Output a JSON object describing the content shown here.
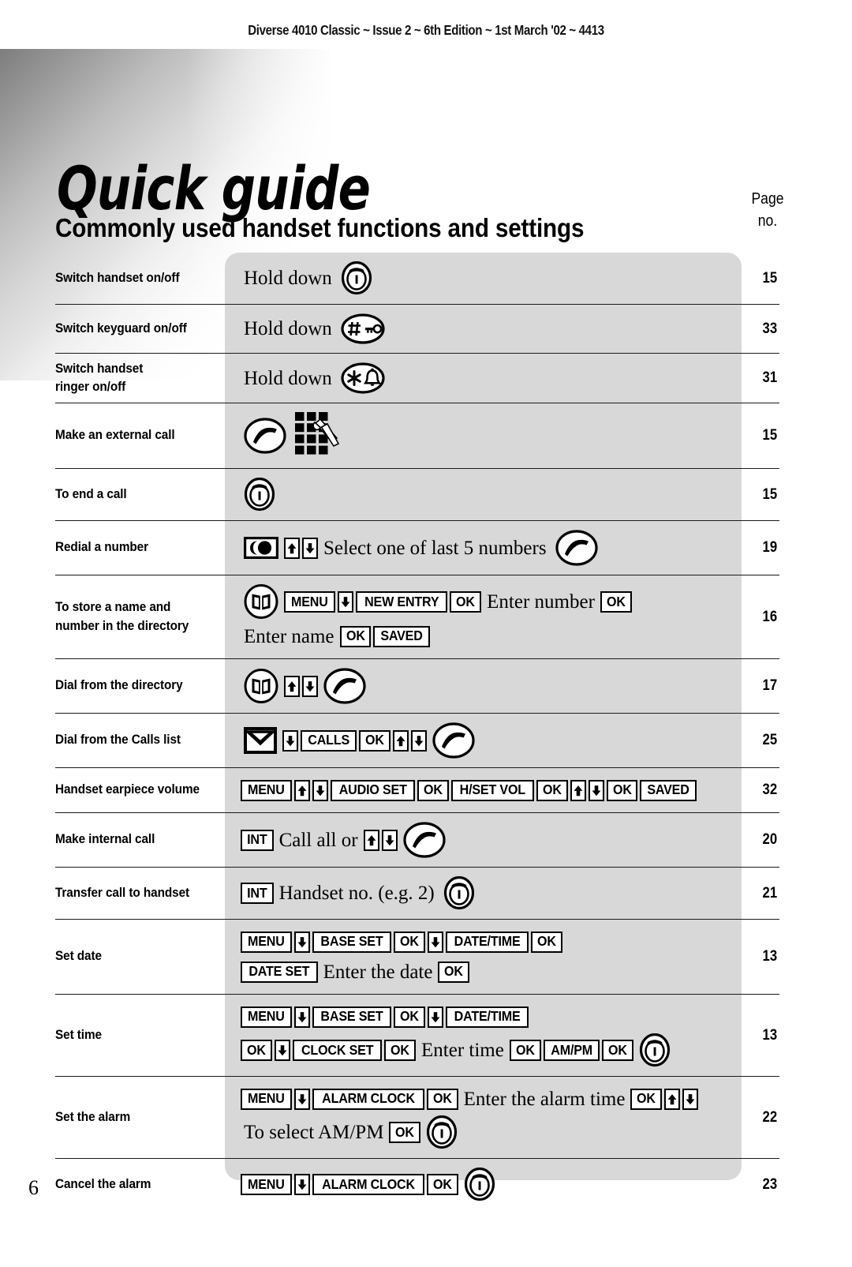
{
  "header": {
    "running_head": "Diverse 4010 Classic ~ Issue 2 ~ 6th Edition ~ 1st March '02 ~ 4413"
  },
  "title": {
    "main": "Quick guide",
    "subtitle": "Commonly used handset functions and settings",
    "page_col_header_line1": "Page",
    "page_col_header_line2": "no."
  },
  "footer": {
    "page_number": "6"
  },
  "colors": {
    "panel_grey": "#d8d8d8",
    "rule": "#1a1a1a",
    "text": "#000000"
  },
  "table": {
    "rows": [
      {
        "label": "Switch handset on/off",
        "page": "15",
        "lines": [
          [
            {
              "type": "word",
              "text": "Hold down"
            },
            {
              "type": "icon",
              "name": "end-call-icon"
            }
          ]
        ]
      },
      {
        "label": "Switch keyguard on/off",
        "page": "33",
        "lines": [
          [
            {
              "type": "word",
              "text": "Hold down"
            },
            {
              "type": "icon",
              "name": "keyguard-icon"
            }
          ]
        ]
      },
      {
        "label": "Switch handset\nringer on/off",
        "page": "31",
        "lines": [
          [
            {
              "type": "word",
              "text": "Hold down"
            },
            {
              "type": "icon",
              "name": "ringer-icon"
            }
          ]
        ]
      },
      {
        "label": "Make an external call",
        "page": "15",
        "lines": [
          [
            {
              "type": "icon",
              "name": "talk-icon"
            },
            {
              "type": "icon",
              "name": "keypad-dial-icon"
            }
          ]
        ]
      },
      {
        "label": "To end a call",
        "page": "15",
        "lines": [
          [
            {
              "type": "icon",
              "name": "end-call-icon"
            }
          ]
        ]
      },
      {
        "label": "Redial a number",
        "page": "19",
        "lines": [
          [
            {
              "type": "icon",
              "name": "redial-key-icon"
            },
            {
              "type": "key-up"
            },
            {
              "type": "key-down"
            },
            {
              "type": "word",
              "text": "Select one of last 5 numbers"
            },
            {
              "type": "icon",
              "name": "talk-icon"
            }
          ]
        ]
      },
      {
        "label": "To store a name and\nnumber in the directory",
        "page": "16",
        "lines": [
          [
            {
              "type": "icon",
              "name": "directory-book-icon"
            },
            {
              "type": "key",
              "text": "MENU"
            },
            {
              "type": "key-down"
            },
            {
              "type": "key",
              "text": "NEW ENTRY"
            },
            {
              "type": "key",
              "text": "OK"
            },
            {
              "type": "word",
              "text": "Enter number"
            },
            {
              "type": "key",
              "text": "OK"
            }
          ],
          [
            {
              "type": "word",
              "text": "Enter name"
            },
            {
              "type": "key",
              "text": "OK"
            },
            {
              "type": "key",
              "text": "SAVED"
            }
          ]
        ]
      },
      {
        "label": "Dial from the directory",
        "page": "17",
        "lines": [
          [
            {
              "type": "icon",
              "name": "directory-book-icon"
            },
            {
              "type": "key-up"
            },
            {
              "type": "key-down"
            },
            {
              "type": "icon",
              "name": "talk-icon"
            }
          ]
        ]
      },
      {
        "label": "Dial from the Calls list",
        "page": "25",
        "lines": [
          [
            {
              "type": "icon",
              "name": "envelope-icon"
            },
            {
              "type": "key-down"
            },
            {
              "type": "key",
              "text": "CALLS"
            },
            {
              "type": "key",
              "text": "OK"
            },
            {
              "type": "key-up"
            },
            {
              "type": "key-down"
            },
            {
              "type": "icon",
              "name": "talk-icon"
            }
          ]
        ]
      },
      {
        "label": "Handset earpiece volume",
        "page": "32",
        "lines": [
          [
            {
              "type": "key",
              "text": "MENU"
            },
            {
              "type": "key-up"
            },
            {
              "type": "key-down"
            },
            {
              "type": "key",
              "text": "AUDIO SET"
            },
            {
              "type": "key",
              "text": "OK"
            },
            {
              "type": "key",
              "text": "H/SET VOL"
            },
            {
              "type": "key",
              "text": "OK"
            },
            {
              "type": "key-up"
            },
            {
              "type": "key-down"
            },
            {
              "type": "key",
              "text": "OK"
            },
            {
              "type": "key",
              "text": "SAVED"
            }
          ]
        ]
      },
      {
        "label": "Make internal call",
        "page": "20",
        "lines": [
          [
            {
              "type": "key",
              "text": "INT"
            },
            {
              "type": "word",
              "text": "Call all or"
            },
            {
              "type": "key-up"
            },
            {
              "type": "key-down"
            },
            {
              "type": "icon",
              "name": "talk-icon"
            }
          ]
        ]
      },
      {
        "label": "Transfer call to handset",
        "page": "21",
        "lines": [
          [
            {
              "type": "key",
              "text": "INT"
            },
            {
              "type": "word",
              "text": "Handset no. (e.g. 2)"
            },
            {
              "type": "icon",
              "name": "end-call-icon"
            }
          ]
        ]
      },
      {
        "label": "Set date",
        "page": "13",
        "lines": [
          [
            {
              "type": "key",
              "text": "MENU"
            },
            {
              "type": "key-down"
            },
            {
              "type": "key",
              "text": "BASE SET"
            },
            {
              "type": "key",
              "text": "OK"
            },
            {
              "type": "key-down"
            },
            {
              "type": "key",
              "text": "DATE/TIME"
            },
            {
              "type": "key",
              "text": "OK"
            }
          ],
          [
            {
              "type": "key",
              "text": "DATE SET"
            },
            {
              "type": "word",
              "text": "Enter the date"
            },
            {
              "type": "key",
              "text": "OK"
            }
          ]
        ]
      },
      {
        "label": "Set time",
        "page": "13",
        "lines": [
          [
            {
              "type": "key",
              "text": "MENU"
            },
            {
              "type": "key-down"
            },
            {
              "type": "key",
              "text": "BASE SET"
            },
            {
              "type": "key",
              "text": "OK"
            },
            {
              "type": "key-down"
            },
            {
              "type": "key",
              "text": "DATE/TIME"
            }
          ],
          [
            {
              "type": "key",
              "text": "OK"
            },
            {
              "type": "key-down"
            },
            {
              "type": "key",
              "text": "CLOCK SET"
            },
            {
              "type": "key",
              "text": "OK"
            },
            {
              "type": "word",
              "text": "Enter time"
            },
            {
              "type": "key",
              "text": "OK"
            },
            {
              "type": "key",
              "text": "AM/PM"
            },
            {
              "type": "key",
              "text": "OK"
            },
            {
              "type": "icon",
              "name": "end-call-icon"
            }
          ]
        ]
      },
      {
        "label": "Set the alarm",
        "page": "22",
        "lines": [
          [
            {
              "type": "key",
              "text": "MENU"
            },
            {
              "type": "key-down"
            },
            {
              "type": "key",
              "text": "ALARM CLOCK"
            },
            {
              "type": "key",
              "text": "OK"
            },
            {
              "type": "word",
              "text": "Enter the alarm time"
            },
            {
              "type": "key",
              "text": "OK"
            },
            {
              "type": "key-up"
            },
            {
              "type": "key-down"
            }
          ],
          [
            {
              "type": "word",
              "text": "To select AM/PM"
            },
            {
              "type": "key",
              "text": "OK"
            },
            {
              "type": "icon",
              "name": "end-call-icon"
            }
          ]
        ]
      },
      {
        "label": "Cancel the alarm",
        "page": "23",
        "lines": [
          [
            {
              "type": "key",
              "text": "MENU"
            },
            {
              "type": "key-down"
            },
            {
              "type": "key",
              "text": "ALARM CLOCK"
            },
            {
              "type": "key",
              "text": "OK"
            },
            {
              "type": "icon",
              "name": "end-call-icon"
            }
          ]
        ]
      }
    ]
  }
}
